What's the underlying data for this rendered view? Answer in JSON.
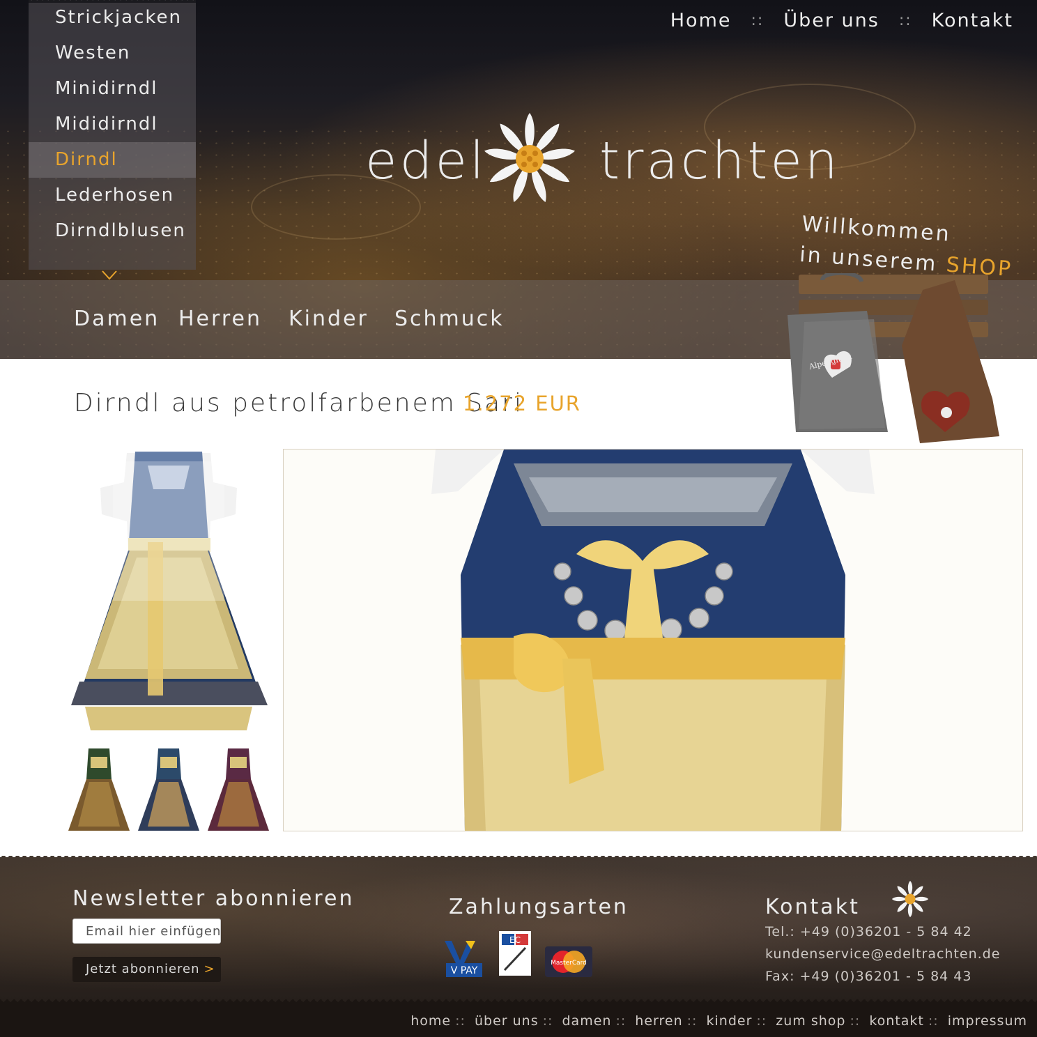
{
  "top_nav": {
    "home": "Home",
    "about": "Über uns",
    "contact": "Kontakt",
    "separator": "::"
  },
  "side_menu": {
    "items": [
      "Strickjacken",
      "Westen",
      "Minidirndl",
      "Mididirndl",
      "Dirndl",
      "Lederhosen",
      "Dirndlblusen"
    ],
    "active_index": 4
  },
  "categories": [
    "Damen",
    "Herren",
    "Kinder",
    "Schmuck"
  ],
  "logo": {
    "word1": "edel",
    "word2": "trachten"
  },
  "welcome": {
    "line1": "Willkommen",
    "line2": "in unserem",
    "shop": "SHOP"
  },
  "bag_label": "Alpenglück",
  "product": {
    "title": "Dirndl aus petrolfarbenem Sari",
    "price": "1.272 EUR"
  },
  "newsletter": {
    "title": "Newsletter abonnieren",
    "placeholder": "Email hier einfügen*",
    "button": "Jetzt abonnieren",
    "button_arrow": ">"
  },
  "payment": {
    "title": "Zahlungsarten",
    "methods": [
      "V PAY",
      "EC",
      "MasterCard"
    ]
  },
  "contact": {
    "title": "Kontakt",
    "phone": "Tel.: +49 (0)36201 - 5 84 42",
    "email": "kundenservice@edeltrachten.de",
    "fax": "Fax: +49 (0)36201 - 5 84 43"
  },
  "footer_links": [
    "home",
    "über uns",
    "damen",
    "herren",
    "kinder",
    "zum shop",
    "kontakt",
    "impressum"
  ],
  "colors": {
    "accent": "#e8a42c",
    "dark": "#1f1915",
    "text": "#3a3a3a"
  }
}
